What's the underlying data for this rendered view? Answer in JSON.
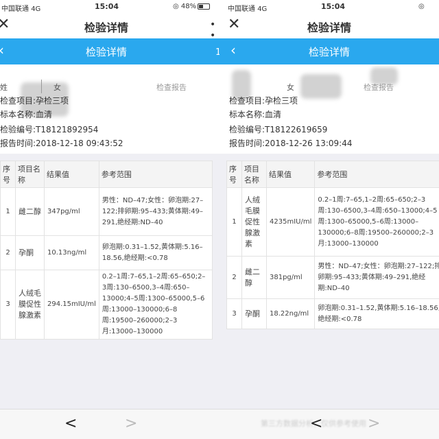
{
  "status": {
    "carrier": "中国联通",
    "network": "4G",
    "time": "15:04",
    "battery": "48%"
  },
  "nav": {
    "title": "检验详情",
    "close_icon": "close-icon",
    "more_label": "• •"
  },
  "bluebar": {
    "title": "检验详情",
    "back_icon": "chevron-left-icon"
  },
  "bottom": {
    "prev_icon": "chevron-left",
    "next_icon": "chevron-right"
  },
  "colors": {
    "accent": "#2aa8ee"
  },
  "left": {
    "badge": "1",
    "tabs": [
      "姓",
      "女",
      "检查报告"
    ],
    "test_item": "检查项目:孕检三项",
    "specimen": "标本名称:血清",
    "report_no": "检验编号:T18121892954",
    "report_time": "报告时间:2018-12-18 09:43:52",
    "headers": {
      "no": "序号",
      "item": "项目名称",
      "value": "结果值",
      "range": "参考范围"
    },
    "rows": [
      {
        "no": "1",
        "item": "雌二醇",
        "value": "347pg/ml",
        "range": "男性：ND–47;女性：卵泡期:27–122;排卵期:95–433;黄体期:49–291,绝经期:ND–40"
      },
      {
        "no": "2",
        "item": "孕酮",
        "value": "10.13ng/ml",
        "range": "卵泡期:0.31–1.52,黄体期:5.16–18.56,绝经期:<0.78"
      },
      {
        "no": "3",
        "item": "人绒毛膜促性腺激素",
        "value": "294.15mIU/ml",
        "range": "0.2–1周:7–65,1–2周:65–650;2–3周:130–6500,3–4周:650–13000;4–5周:1300–65000,5–6周:13000–130000;6–8周:19500–260000;2–3月:13000–130000"
      }
    ]
  },
  "right": {
    "tabs": [
      "姓",
      "女",
      "检查报告"
    ],
    "test_item": "检查项目:孕检三项",
    "specimen": "标本名称:血清",
    "report_no": "检验编号:T18122619659",
    "report_time": "报告时间:2018-12-26 13:09:44",
    "headers": {
      "no": "序号",
      "item": "项目名称",
      "value": "结果值",
      "range": "参考范围"
    },
    "rows": [
      {
        "no": "1",
        "item": "人绒毛膜促性腺激素",
        "value": "4235mIU/ml",
        "range": "0.2–1周:7–65,1–2周:65–650;2–3周:130–6500,3–4周:650–13000;4–5周:1300–65000,5–6周:13000–130000;6–8周:19500–260000;2–3月:13000–130000"
      },
      {
        "no": "2",
        "item": "雌二醇",
        "value": "381pg/ml",
        "range": "男性：ND–47;女性：卵泡期:27–122;排卵期:95–433;黄体期:49–291,绝经期:ND–40"
      },
      {
        "no": "3",
        "item": "孕酮",
        "value": "18.22ng/ml",
        "range": "卵泡期:0.31–1.52,黄体期:5.16–18.56,绝经期:<0.78"
      }
    ],
    "watermark": "第三方数据分析，仅供参考使用"
  }
}
